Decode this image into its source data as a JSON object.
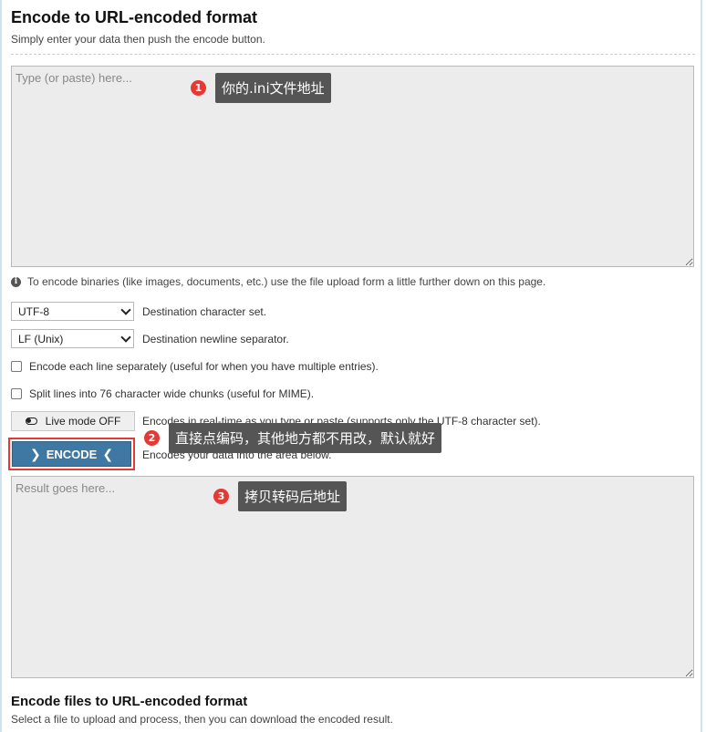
{
  "page": {
    "title": "Encode to URL-encoded format",
    "subtitle": "Simply enter your data then push the encode button."
  },
  "input": {
    "placeholder": "Type (or paste) here..."
  },
  "info": {
    "icon": "info-icon",
    "text": "To encode binaries (like images, documents, etc.) use the file upload form a little further down on this page."
  },
  "options": {
    "charset": {
      "value": "UTF-8",
      "label": "Destination character set."
    },
    "newline": {
      "value": "LF (Unix)",
      "label": "Destination newline separator."
    },
    "each_line": {
      "label": "Encode each line separately (useful for when you have multiple entries)."
    },
    "split_lines": {
      "label": "Split lines into 76 character wide chunks (useful for MIME)."
    },
    "live_mode": {
      "label": "Live mode OFF",
      "description": "Encodes in real-time as you type or paste (supports only the UTF-8 character set)."
    }
  },
  "encode": {
    "label": "ENCODE",
    "description": "Encodes your data into the area below."
  },
  "result": {
    "placeholder": "Result goes here..."
  },
  "files_section": {
    "title": "Encode files to URL-encoded format",
    "subtitle": "Select a file to upload and process, then you can download the encoded result."
  },
  "annotations": [
    {
      "number": "1",
      "text": "你的.ini文件地址"
    },
    {
      "number": "2",
      "text": "直接点编码，其他地方都不用改，默认就好"
    },
    {
      "number": "3",
      "text": "拷贝转码后地址"
    }
  ],
  "colors": {
    "accent": "#3f78a2",
    "badge": "#e53935",
    "tooltip": "#555555",
    "field_bg": "#ececec"
  }
}
